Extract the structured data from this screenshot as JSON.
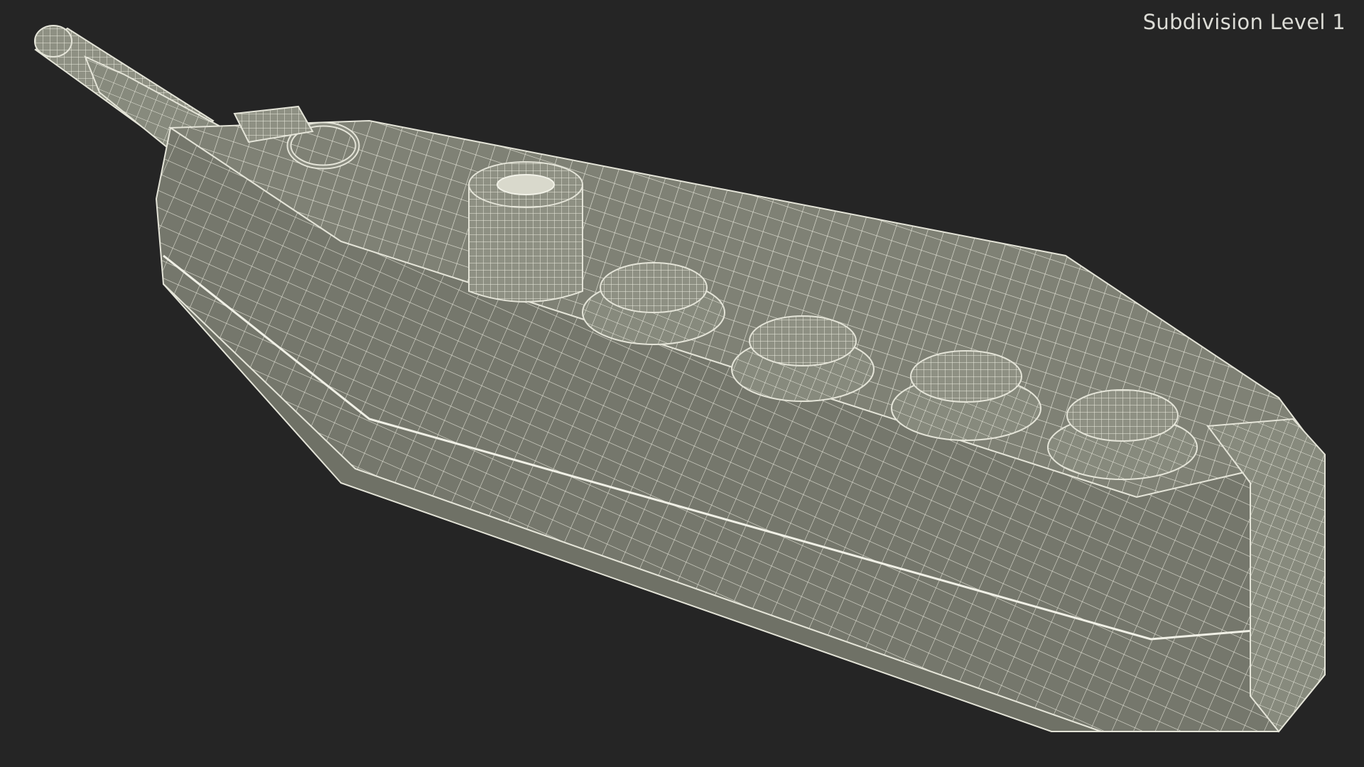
{
  "viewport": {
    "label": "Subdivision Level 1",
    "background": "#252525"
  },
  "model": {
    "icon": "wireframe-pendant-control-icon",
    "surface_color": "#7f8175",
    "wire_color": "#e4e4d8"
  }
}
